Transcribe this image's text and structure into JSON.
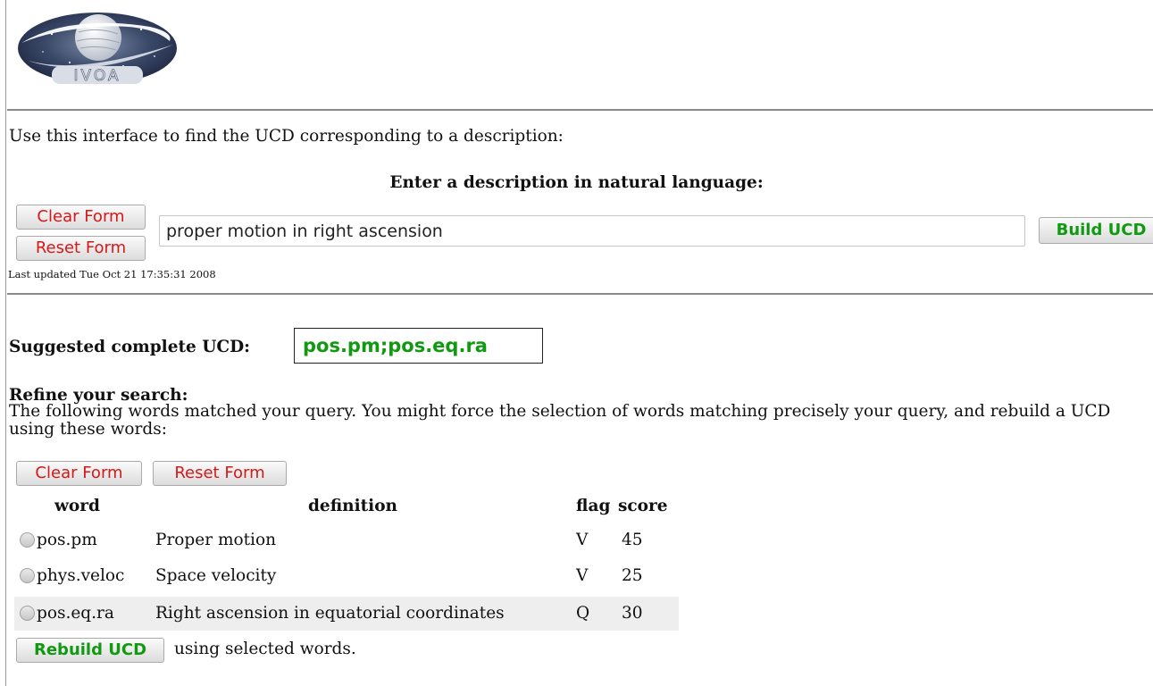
{
  "logo": {
    "text": "IVOA"
  },
  "intro": "Use this interface to find the UCD corresponding to a description:",
  "form": {
    "heading": "Enter a description in natural language:",
    "clear_label": "Clear Form",
    "reset_label": "Reset Form",
    "description_value": "proper motion in right ascension",
    "build_label": "Build UCD",
    "last_updated": "Last updated Tue Oct 21 17:35:31 2008"
  },
  "suggestion": {
    "label": "Suggested complete UCD:",
    "ucd": "pos.pm;pos.eq.ra"
  },
  "refine": {
    "title": "Refine your search:",
    "text": "The following words matched your query. You might force the selection of words matching precisely your query, and rebuild a UCD using these words:",
    "clear_label": "Clear Form",
    "reset_label": "Reset Form",
    "columns": {
      "word": "word",
      "definition": "definition",
      "flag": "flag",
      "score": "score"
    },
    "rows": [
      {
        "word": "pos.pm",
        "definition": "Proper motion",
        "flag": "V",
        "score": "45",
        "checked": false
      },
      {
        "word": "phys.veloc",
        "definition": "Space velocity",
        "flag": "V",
        "score": "25",
        "checked": false
      },
      {
        "word": "pos.eq.ra",
        "definition": "Right ascension in equatorial coordinates",
        "flag": "Q",
        "score": "30",
        "checked": false
      }
    ],
    "rebuild_label": "Rebuild UCD",
    "rebuild_suffix": "using selected words."
  },
  "colors": {
    "button_red": "#d51818",
    "button_green": "#119a11",
    "highlight_row": "#eeeeee"
  }
}
